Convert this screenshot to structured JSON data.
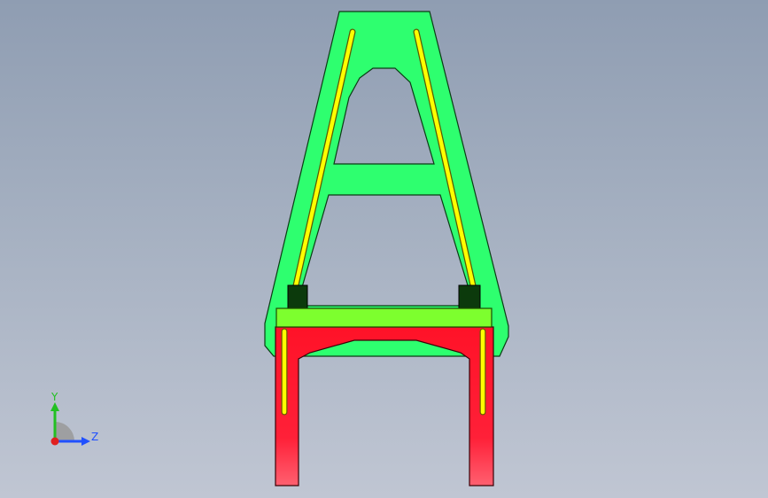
{
  "viewport": {
    "background_top": "#8f9db2",
    "background_bottom": "#c0c6d3"
  },
  "model": {
    "frame_color": "#2eff6f",
    "crossbar_color": "#7dff2e",
    "base_color": "#ff1a2e",
    "rail_color": "#ffff00",
    "block_color": "#0c3a0c"
  },
  "triad": {
    "y_label": "Y",
    "z_label": "Z",
    "y_color": "#22c022",
    "z_color": "#2050ff",
    "x_color": "#e02020"
  }
}
